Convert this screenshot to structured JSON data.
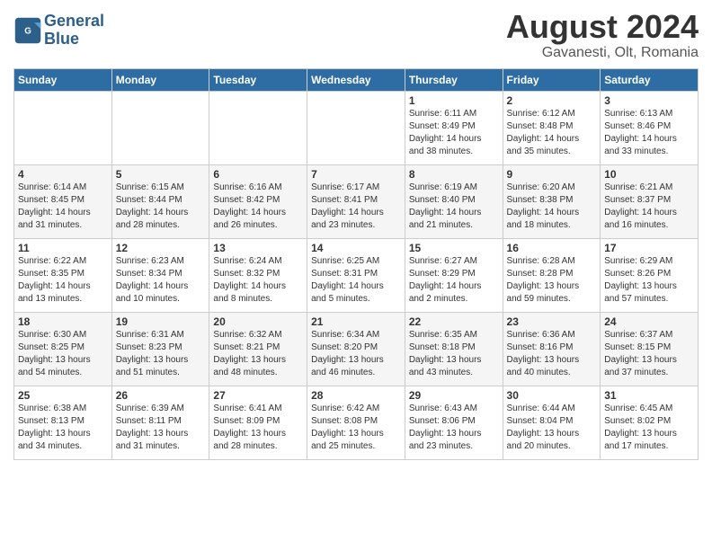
{
  "header": {
    "logo_line1": "General",
    "logo_line2": "Blue",
    "month_year": "August 2024",
    "location": "Gavanesti, Olt, Romania"
  },
  "days_of_week": [
    "Sunday",
    "Monday",
    "Tuesday",
    "Wednesday",
    "Thursday",
    "Friday",
    "Saturday"
  ],
  "weeks": [
    [
      {
        "day": "",
        "info": ""
      },
      {
        "day": "",
        "info": ""
      },
      {
        "day": "",
        "info": ""
      },
      {
        "day": "",
        "info": ""
      },
      {
        "day": "1",
        "info": "Sunrise: 6:11 AM\nSunset: 8:49 PM\nDaylight: 14 hours\nand 38 minutes."
      },
      {
        "day": "2",
        "info": "Sunrise: 6:12 AM\nSunset: 8:48 PM\nDaylight: 14 hours\nand 35 minutes."
      },
      {
        "day": "3",
        "info": "Sunrise: 6:13 AM\nSunset: 8:46 PM\nDaylight: 14 hours\nand 33 minutes."
      }
    ],
    [
      {
        "day": "4",
        "info": "Sunrise: 6:14 AM\nSunset: 8:45 PM\nDaylight: 14 hours\nand 31 minutes."
      },
      {
        "day": "5",
        "info": "Sunrise: 6:15 AM\nSunset: 8:44 PM\nDaylight: 14 hours\nand 28 minutes."
      },
      {
        "day": "6",
        "info": "Sunrise: 6:16 AM\nSunset: 8:42 PM\nDaylight: 14 hours\nand 26 minutes."
      },
      {
        "day": "7",
        "info": "Sunrise: 6:17 AM\nSunset: 8:41 PM\nDaylight: 14 hours\nand 23 minutes."
      },
      {
        "day": "8",
        "info": "Sunrise: 6:19 AM\nSunset: 8:40 PM\nDaylight: 14 hours\nand 21 minutes."
      },
      {
        "day": "9",
        "info": "Sunrise: 6:20 AM\nSunset: 8:38 PM\nDaylight: 14 hours\nand 18 minutes."
      },
      {
        "day": "10",
        "info": "Sunrise: 6:21 AM\nSunset: 8:37 PM\nDaylight: 14 hours\nand 16 minutes."
      }
    ],
    [
      {
        "day": "11",
        "info": "Sunrise: 6:22 AM\nSunset: 8:35 PM\nDaylight: 14 hours\nand 13 minutes."
      },
      {
        "day": "12",
        "info": "Sunrise: 6:23 AM\nSunset: 8:34 PM\nDaylight: 14 hours\nand 10 minutes."
      },
      {
        "day": "13",
        "info": "Sunrise: 6:24 AM\nSunset: 8:32 PM\nDaylight: 14 hours\nand 8 minutes."
      },
      {
        "day": "14",
        "info": "Sunrise: 6:25 AM\nSunset: 8:31 PM\nDaylight: 14 hours\nand 5 minutes."
      },
      {
        "day": "15",
        "info": "Sunrise: 6:27 AM\nSunset: 8:29 PM\nDaylight: 14 hours\nand 2 minutes."
      },
      {
        "day": "16",
        "info": "Sunrise: 6:28 AM\nSunset: 8:28 PM\nDaylight: 13 hours\nand 59 minutes."
      },
      {
        "day": "17",
        "info": "Sunrise: 6:29 AM\nSunset: 8:26 PM\nDaylight: 13 hours\nand 57 minutes."
      }
    ],
    [
      {
        "day": "18",
        "info": "Sunrise: 6:30 AM\nSunset: 8:25 PM\nDaylight: 13 hours\nand 54 minutes."
      },
      {
        "day": "19",
        "info": "Sunrise: 6:31 AM\nSunset: 8:23 PM\nDaylight: 13 hours\nand 51 minutes."
      },
      {
        "day": "20",
        "info": "Sunrise: 6:32 AM\nSunset: 8:21 PM\nDaylight: 13 hours\nand 48 minutes."
      },
      {
        "day": "21",
        "info": "Sunrise: 6:34 AM\nSunset: 8:20 PM\nDaylight: 13 hours\nand 46 minutes."
      },
      {
        "day": "22",
        "info": "Sunrise: 6:35 AM\nSunset: 8:18 PM\nDaylight: 13 hours\nand 43 minutes."
      },
      {
        "day": "23",
        "info": "Sunrise: 6:36 AM\nSunset: 8:16 PM\nDaylight: 13 hours\nand 40 minutes."
      },
      {
        "day": "24",
        "info": "Sunrise: 6:37 AM\nSunset: 8:15 PM\nDaylight: 13 hours\nand 37 minutes."
      }
    ],
    [
      {
        "day": "25",
        "info": "Sunrise: 6:38 AM\nSunset: 8:13 PM\nDaylight: 13 hours\nand 34 minutes."
      },
      {
        "day": "26",
        "info": "Sunrise: 6:39 AM\nSunset: 8:11 PM\nDaylight: 13 hours\nand 31 minutes."
      },
      {
        "day": "27",
        "info": "Sunrise: 6:41 AM\nSunset: 8:09 PM\nDaylight: 13 hours\nand 28 minutes."
      },
      {
        "day": "28",
        "info": "Sunrise: 6:42 AM\nSunset: 8:08 PM\nDaylight: 13 hours\nand 25 minutes."
      },
      {
        "day": "29",
        "info": "Sunrise: 6:43 AM\nSunset: 8:06 PM\nDaylight: 13 hours\nand 23 minutes."
      },
      {
        "day": "30",
        "info": "Sunrise: 6:44 AM\nSunset: 8:04 PM\nDaylight: 13 hours\nand 20 minutes."
      },
      {
        "day": "31",
        "info": "Sunrise: 6:45 AM\nSunset: 8:02 PM\nDaylight: 13 hours\nand 17 minutes."
      }
    ]
  ]
}
